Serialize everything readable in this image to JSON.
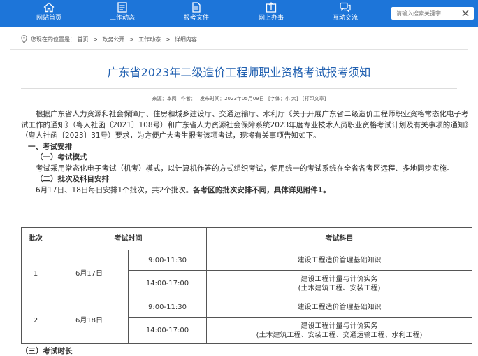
{
  "nav": {
    "items": [
      {
        "label": "网站首页",
        "icon": "home-icon"
      },
      {
        "label": "工作动态",
        "icon": "document-list-icon"
      },
      {
        "label": "报考文件",
        "icon": "file-icon"
      },
      {
        "label": "网上办事",
        "icon": "upload-icon"
      },
      {
        "label": "互动交流",
        "icon": "chat-bubbles-icon"
      }
    ],
    "search_placeholder": "请输入搜索关键字",
    "accent_color": "#1d75d9"
  },
  "breadcrumb": {
    "prefix": "您现在的位置是：",
    "items": [
      "首页",
      "政务公开",
      "工作动态",
      "详细内容"
    ],
    "separator": ">"
  },
  "article": {
    "title": "广东省2023年二级造价工程师职业资格考试报考须知",
    "meta": {
      "source": "来源：本网",
      "author": "作者：",
      "date": "发布时间：2023年05月09日",
      "font_size": "[字体：小 大]",
      "print": "[打印文章]"
    },
    "intro": "根据广东省人力资源和社会保障厅、住房和城乡建设厅、交通运输厅、水利厅《关于开展广东省二级造价工程师职业资格常态化电子考试工作的通知》（粤人社函〔2021〕108号）和广东省人力资源社会保障系统2023年度专业技术人员职业资格考试计划及有关事项的通知》（粤人社函〔2023〕31号）要求，为方便广大考生报考该项考试，现将有关事项告知如下。",
    "section1": "一、考试安排",
    "sub1": "（一）考试模式",
    "sub1_text": "考试采用常态化电子考试（机考）模式，以计算机作答的方式组织考试，使用统一的考试系统在全省各考区远程、多地同步实施。",
    "sub2": "（二）批次及科目安排",
    "sub2_text": "6月17日、18日每日安排1个批次，共2个批次。",
    "sub2_bold": "各考区的批次安排不同，具体详见附件1。",
    "cut_off": "（三）考试时长"
  },
  "schedule_table": {
    "headers": [
      "批次",
      "考试时间",
      "考试科目"
    ],
    "batches": [
      {
        "batch": "1",
        "date": "6月17日",
        "sessions": [
          {
            "time": "9:00-11:30",
            "subject": "建设工程造价管理基础知识",
            "subject_line2": ""
          },
          {
            "time": "14:00-17:00",
            "subject": "建设工程计量与计价实务",
            "subject_line2": "(土木建筑工程、安装工程)"
          }
        ]
      },
      {
        "batch": "2",
        "date": "6月18日",
        "sessions": [
          {
            "time": "9:00-11:30",
            "subject": "建设工程造价管理基础知识",
            "subject_line2": ""
          },
          {
            "time": "14:00-17:00",
            "subject": "建设工程计量与计价实务",
            "subject_line2": "(土木建筑工程、安装工程、交通运输工程、水利工程)"
          }
        ]
      }
    ]
  }
}
